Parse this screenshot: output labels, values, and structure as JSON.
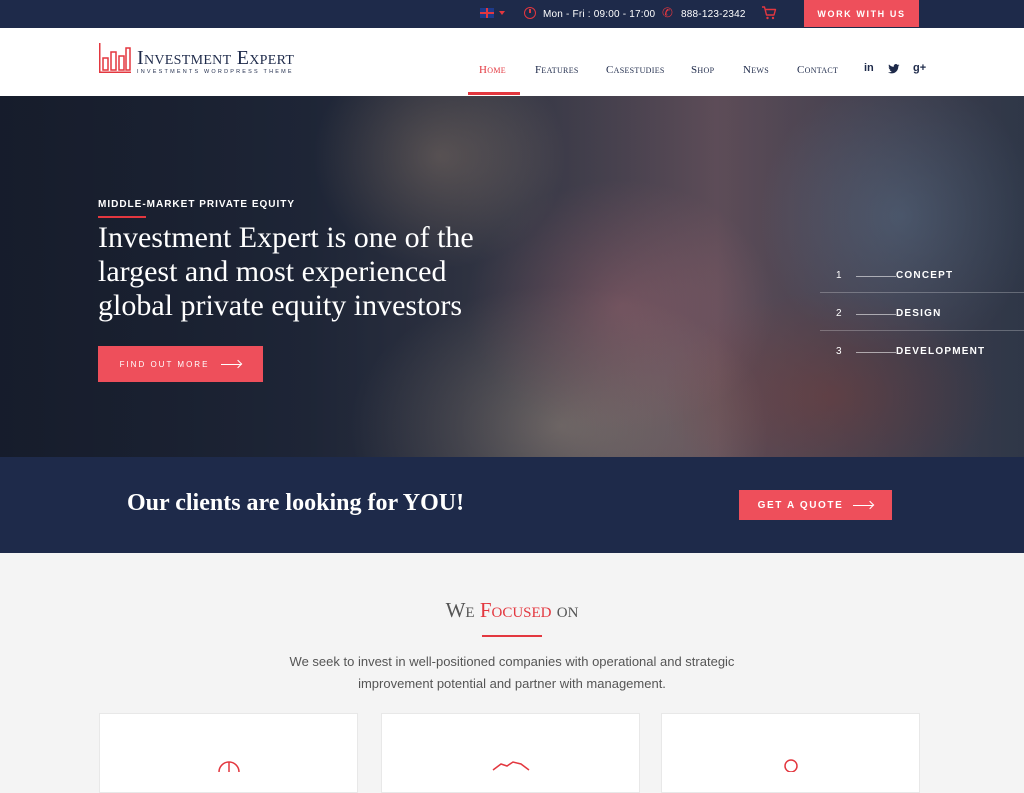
{
  "topbar": {
    "language": "English",
    "hours": "Mon - Fri : 09:00 - 17:00",
    "phone": "888-123-2342",
    "cta": "WORK WITH US",
    "icons": [
      "uk-flag-icon",
      "clock-icon",
      "phone-icon",
      "cart-icon"
    ]
  },
  "header": {
    "logo_title": "Investment Expert",
    "logo_subtitle": "INVESTMENTS WORDPRESS THEME",
    "nav": [
      {
        "label": "Home",
        "active": true
      },
      {
        "label": "Features"
      },
      {
        "label": "Casestudies"
      },
      {
        "label": "Shop"
      },
      {
        "label": "News"
      },
      {
        "label": "Contact"
      }
    ],
    "social": {
      "linkedin": "in",
      "twitter": "t",
      "googleplus": "g+"
    }
  },
  "hero": {
    "kicker": "MIDDLE-MARKET PRIVATE EQUITY",
    "headline": "Investment Expert is one of the largest and most experienced global private equity investors",
    "button": "FIND OUT MORE",
    "steps": [
      {
        "num": "1",
        "label": "CONCEPT"
      },
      {
        "num": "2",
        "label": "DESIGN"
      },
      {
        "num": "3",
        "label": "DEVELOPMENT"
      }
    ]
  },
  "quote_bar": {
    "text": "Our clients are looking for YOU!",
    "button": "GET A QUOTE"
  },
  "focus": {
    "title_prefix": "We",
    "title_accent": "Focused",
    "title_suffix": "on",
    "description": "We seek to invest in well-positioned companies with operational and strategic improvement potential and partner with management."
  },
  "colors": {
    "navy": "#1e2a4a",
    "accent": "#ee4f5b",
    "red": "#e3373f"
  }
}
